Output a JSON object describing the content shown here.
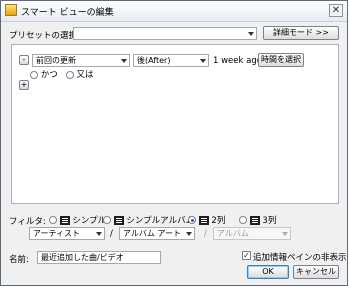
{
  "window": {
    "title": "スマート ビューの編集",
    "close_glyph": "✕"
  },
  "preset": {
    "label": "プリセットの選択:",
    "value": "",
    "details_button": "詳細モード >>"
  },
  "rule": {
    "remove_glyph": "-",
    "field": "前回の更新",
    "operator": "後(After)",
    "value": "1 week ago",
    "time_button": "時間を選択",
    "and_label": "かつ",
    "or_label": "又は",
    "add_glyph": "+"
  },
  "filter": {
    "label": "フィルタ:",
    "options": [
      {
        "label": "シンプル",
        "selected": false
      },
      {
        "label": "シンプルアルバム",
        "selected": false
      },
      {
        "label": "2列",
        "selected": true
      },
      {
        "label": "3列",
        "selected": false
      }
    ],
    "column1": "アーティスト",
    "separator1": "/",
    "column2": "アルバム アート",
    "separator2": "/",
    "column3": "アルバム"
  },
  "name": {
    "label": "名前:",
    "value": "最近追加した曲/ビデオ"
  },
  "hide_info_pane": {
    "label": "追加情報ペインの非表示",
    "checked": true,
    "check_glyph": "✓"
  },
  "buttons": {
    "ok": "OK",
    "cancel": "キャンセル"
  }
}
